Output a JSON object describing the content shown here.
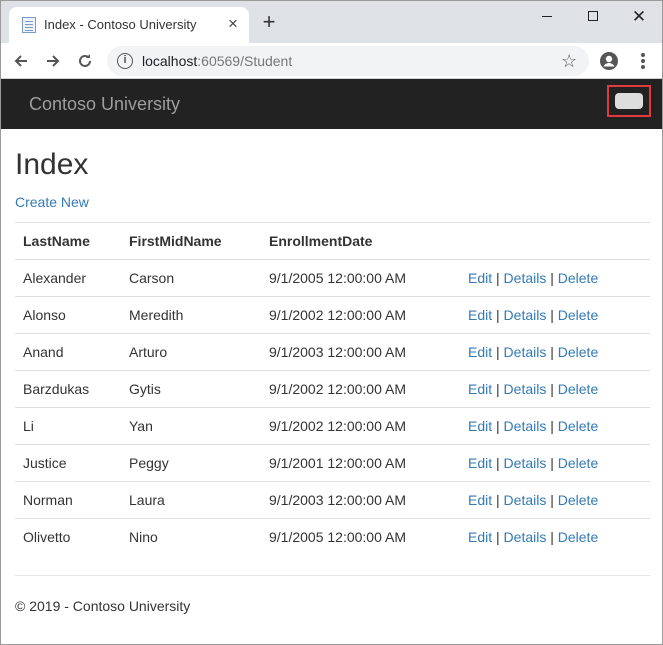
{
  "browser": {
    "tab": {
      "title": "Index - Contoso University",
      "favicon": "page-icon",
      "close": "×"
    },
    "new_tab": "+",
    "window_controls": {
      "close": "✕"
    },
    "address": {
      "host": "localhost",
      "rest": ":60569/Student"
    }
  },
  "site": {
    "brand": "Contoso University",
    "nav_toggle": "navbar-toggle-button"
  },
  "page": {
    "title": "Index",
    "create_link": "Create New",
    "table": {
      "headers": [
        "LastName",
        "FirstMidName",
        "EnrollmentDate",
        ""
      ],
      "rows": [
        [
          "Alexander",
          "Carson",
          "9/1/2005 12:00:00 AM"
        ],
        [
          "Alonso",
          "Meredith",
          "9/1/2002 12:00:00 AM"
        ],
        [
          "Anand",
          "Arturo",
          "9/1/2003 12:00:00 AM"
        ],
        [
          "Barzdukas",
          "Gytis",
          "9/1/2002 12:00:00 AM"
        ],
        [
          "Li",
          "Yan",
          "9/1/2002 12:00:00 AM"
        ],
        [
          "Justice",
          "Peggy",
          "9/1/2001 12:00:00 AM"
        ],
        [
          "Norman",
          "Laura",
          "9/1/2003 12:00:00 AM"
        ],
        [
          "Olivetto",
          "Nino",
          "9/1/2005 12:00:00 AM"
        ]
      ],
      "actions": {
        "edit": "Edit",
        "details": "Details",
        "delete": "Delete",
        "separator": "|"
      }
    }
  },
  "footer": {
    "text": "© 2019 - Contoso University"
  },
  "colors": {
    "navbar": "#222222",
    "link": "#337ab7",
    "highlight": "#e0393e"
  }
}
